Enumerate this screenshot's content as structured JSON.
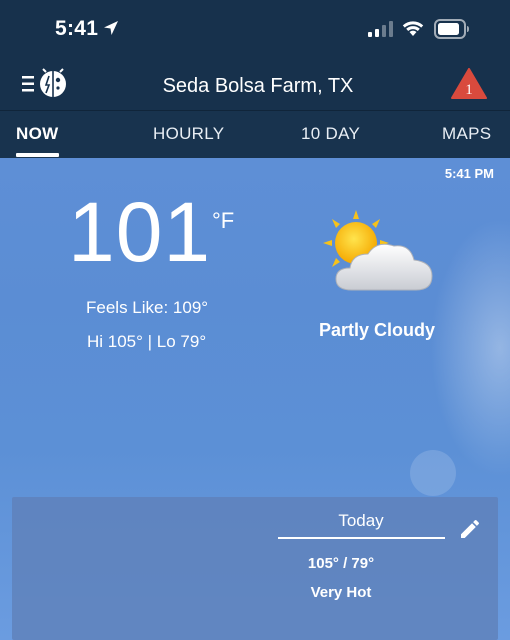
{
  "status_bar": {
    "time": "5:41"
  },
  "header": {
    "location": "Seda Bolsa Farm, TX",
    "alert_count": "1"
  },
  "tabs": [
    {
      "label": "NOW",
      "active": true
    },
    {
      "label": "HOURLY",
      "active": false
    },
    {
      "label": "10 DAY",
      "active": false
    },
    {
      "label": "MAPS",
      "active": false
    }
  ],
  "current": {
    "updated_time": "5:41 PM",
    "temperature": "101",
    "unit": "°F",
    "feels_like": "Feels Like: 109°",
    "hi_lo": "Hi 105° | Lo 79°",
    "condition": "Partly Cloudy",
    "condition_icon": "partly-cloudy-icon"
  },
  "forecast": {
    "day": "Today",
    "hi_lo": "105° / 79°",
    "description": "Very Hot"
  },
  "colors": {
    "header_bg": "#17314c",
    "sky": "#5e8fd6",
    "alert": "#d94a3d"
  }
}
